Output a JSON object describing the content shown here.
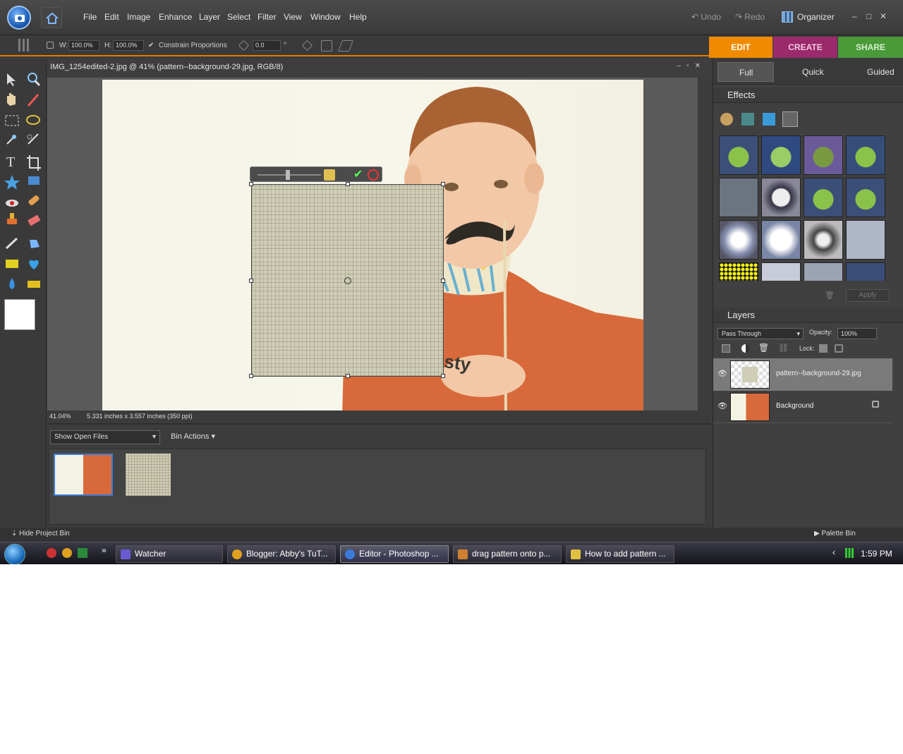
{
  "menubar": {
    "items": [
      "File",
      "Edit",
      "Image",
      "Enhance",
      "Layer",
      "Select",
      "Filter",
      "View",
      "Window",
      "Help"
    ],
    "undo": "Undo",
    "redo": "Redo",
    "organizer": "Organizer",
    "minimize": "–",
    "maximize": "□",
    "close": "✕"
  },
  "options": {
    "w_label": "W:",
    "w_value": "100.0%",
    "h_label": "H:",
    "h_value": "100.0%",
    "constrain": "Constrain Proportions",
    "angle_value": "0.0",
    "degree": "°"
  },
  "mode_tabs": [
    {
      "label": "EDIT",
      "color": "#f08a00"
    },
    {
      "label": "CREATE",
      "color": "#9a2a6b"
    },
    {
      "label": "SHARE",
      "color": "#4a9a3a"
    }
  ],
  "document": {
    "title": "IMG_1254edited-2.jpg @ 41% (pattern--background-29.jpg, RGB/8)",
    "zoom": "41.04%",
    "info": "5.331 inches x 3.557 inches (350 ppi)"
  },
  "bin": {
    "show_open_files": "Show Open Files",
    "bin_actions": "Bin Actions"
  },
  "bottombar": {
    "hide_bin": "Hide Project Bin",
    "palette_bin": "Palette Bin"
  },
  "right": {
    "modes": [
      "Full",
      "Quick",
      "Guided"
    ],
    "effects_title": "Effects",
    "apply": "Apply",
    "layers_title": "Layers",
    "blend_mode": "Pass Through",
    "opacity_label": "Opacity:",
    "opacity_value": "100%",
    "lock_label": "Lock:",
    "layers": [
      {
        "name": "pattern--background-29.jpg"
      },
      {
        "name": "Background"
      }
    ]
  },
  "taskbar": {
    "tasks": [
      "Watcher",
      "Blogger: Abby's TuT...",
      "Editor - Photoshop ...",
      "drag pattern onto p...",
      "How to add pattern ..."
    ],
    "clock": "1:59 PM"
  }
}
